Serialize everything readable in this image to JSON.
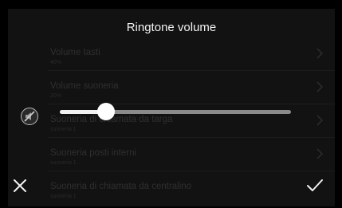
{
  "dialog": {
    "title": "Ringtone volume",
    "volume_level_percent": 20
  },
  "settings_list": [
    {
      "label": "Volume tasti",
      "value": "40%"
    },
    {
      "label": "Volume suoneria",
      "value": "20%"
    },
    {
      "label": "Suoneria di chiamata da targa",
      "value": "suoneria 1"
    },
    {
      "label": "Suoneria posti interni",
      "value": "suoneria 1"
    },
    {
      "label": "Suoneria di chiamata da centralino",
      "value": "suoneria 1"
    }
  ],
  "icons": {
    "mute": "speaker-muted-icon",
    "close": "close-icon",
    "confirm": "check-icon",
    "row_arrow": "chevron-right-icon"
  },
  "colors": {
    "background": "#000000",
    "panel": "#121212",
    "text_primary": "#f2f2f2",
    "slider_track": "#8a8a8a",
    "slider_fill": "#f2f2f2"
  }
}
